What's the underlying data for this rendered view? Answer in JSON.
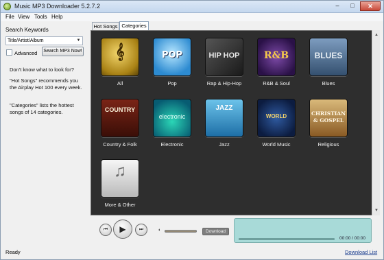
{
  "window": {
    "title": "Music MP3 Downloader  5.2.7.2",
    "minimize": "–",
    "maximize": "□",
    "close": "✕"
  },
  "menu": [
    "File",
    "View",
    "Tools",
    "Help"
  ],
  "search": {
    "label": "Search Keywords",
    "select_value": "Title/Artist/Album",
    "advanced_label": "Advanced",
    "advanced_checked": false,
    "button_label": "Search MP3 Now!"
  },
  "help": {
    "intro": "Don't know what to look for?",
    "hot_songs": "\"Hot Songs\" recommends you the Airplay Hot 100 every week.",
    "categories": "\"Categories\" lists the hottest songs of 14 categories."
  },
  "tabs": [
    {
      "label": "Hot Songs",
      "active": false
    },
    {
      "label": "Categories",
      "active": true
    }
  ],
  "categories": [
    {
      "label": "All",
      "icon": "treble-clef-icon",
      "art_text": "𝄞"
    },
    {
      "label": "Pop",
      "icon": "pop-icon",
      "art_text": "POP"
    },
    {
      "label": "Rap & Hip-Hop",
      "icon": "hip-hop-icon",
      "art_text": "HIP HOP"
    },
    {
      "label": "R&B & Soul",
      "icon": "rnb-icon",
      "art_text": "R&B"
    },
    {
      "label": "Blues",
      "icon": "blues-icon",
      "art_text": "BLUES"
    },
    {
      "label": "Country & Folk",
      "icon": "country-icon",
      "art_text": "COUNTRY"
    },
    {
      "label": "Electronic",
      "icon": "electronic-icon",
      "art_text": "electronic"
    },
    {
      "label": "Jazz",
      "icon": "jazz-icon",
      "art_text": "JAZZ"
    },
    {
      "label": "World Music",
      "icon": "world-icon",
      "art_text": "WORLD"
    },
    {
      "label": "Religious",
      "icon": "religious-icon",
      "art_text": "CHRISTIAN & GOSPEL"
    },
    {
      "label": "More & Other",
      "icon": "music-note-icon",
      "art_text": "♫"
    }
  ],
  "player": {
    "prev_icon": "⏮",
    "play_icon": "▶",
    "next_icon": "⏭",
    "volume_icon": "◖",
    "download_label": "Download",
    "time": "00:00 / 00:00"
  },
  "status": {
    "text": "Ready",
    "download_list": "Download List"
  }
}
